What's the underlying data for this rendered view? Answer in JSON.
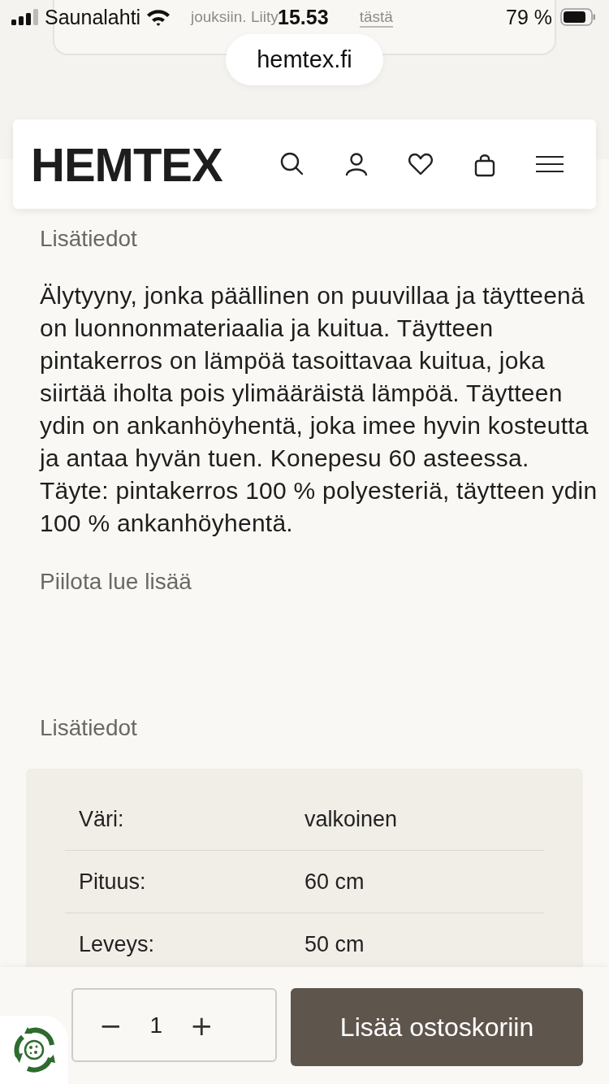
{
  "banner": {
    "text": "jouksiin. Liity",
    "link": "tästä"
  },
  "status_bar": {
    "carrier": "Saunalahti",
    "time": "15.53",
    "battery": "79 %"
  },
  "address_bar": {
    "url": "hemtex.fi"
  },
  "header": {
    "logo": "HEMTEX"
  },
  "description": {
    "heading": "Lisätiedot",
    "text": "Älytyyny, jonka päällinen on puuvillaa ja täytteenä on luonnonmateriaalia ja kuitua. Täytteen pintakerros on lämpöä tasoittavaa kuitua, joka siirtää iholta pois ylimääräistä lämpöä. Täytteen ydin on ankanhöyhentä, joka imee hyvin kosteutta ja antaa hyvän tuen. Konepesu 60 asteessa. Täyte: pintakerros 100 % polyesteriä, täytteen ydin 100 % ankanhöyhentä.",
    "toggle": "Piilota lue lisää"
  },
  "details": {
    "heading": "Lisätiedot",
    "rows": [
      {
        "label": "Väri:",
        "value": "valkoinen"
      },
      {
        "label": "Pituus:",
        "value": "60 cm"
      },
      {
        "label": "Leveys:",
        "value": "50 cm"
      }
    ]
  },
  "cart": {
    "decrement": "−",
    "quantity": "1",
    "increment": "+",
    "button": "Lisää ostoskoriin"
  }
}
